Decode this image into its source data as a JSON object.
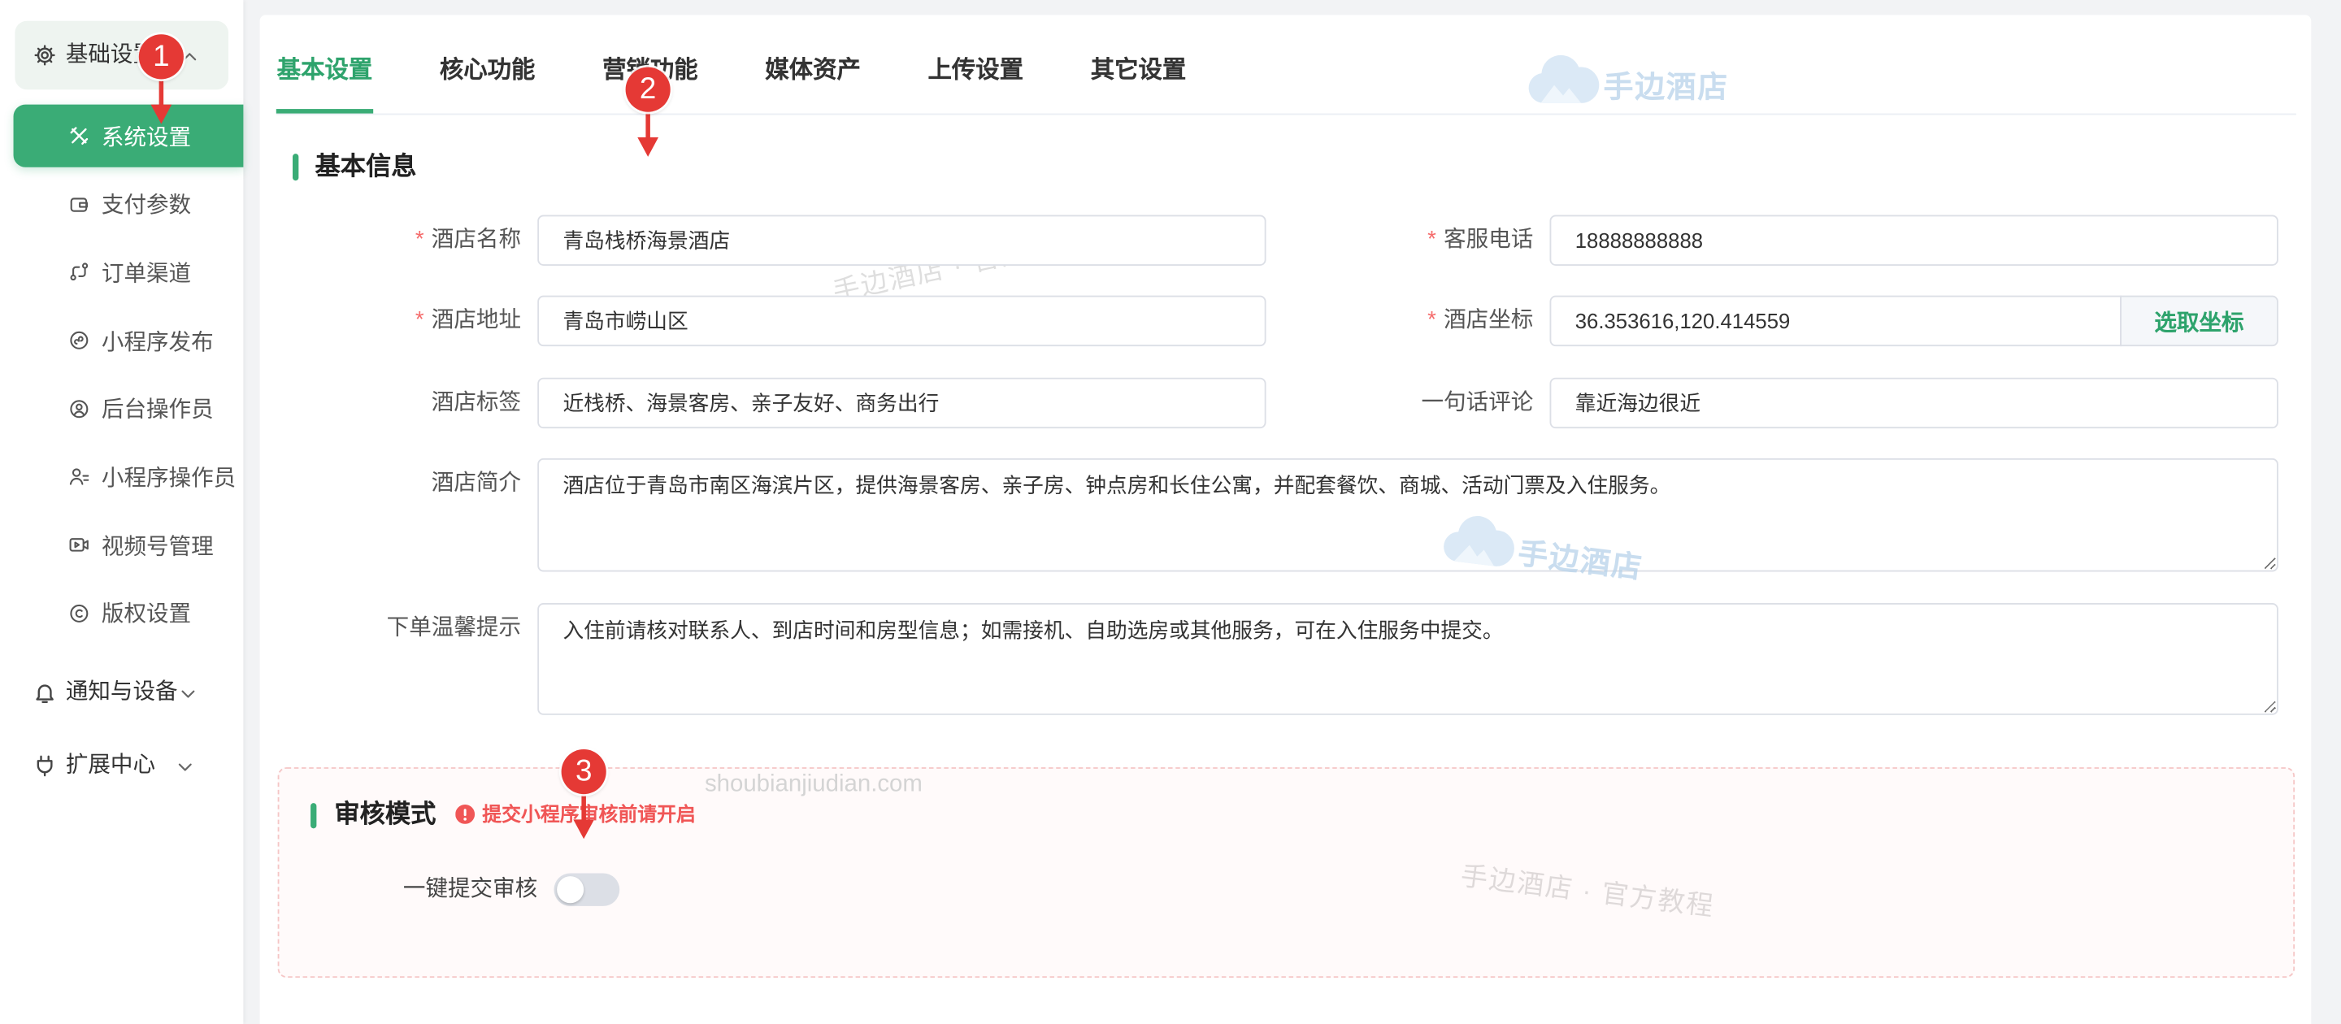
{
  "sidebar": {
    "basic_group": {
      "label": "基础设置",
      "icon": "gear-icon",
      "chevron": "chevron-up-icon"
    },
    "items": [
      {
        "label": "系统设置",
        "icon": "tools-icon",
        "active": true
      },
      {
        "label": "支付参数",
        "icon": "wallet-icon",
        "active": false
      },
      {
        "label": "订单渠道",
        "icon": "route-icon",
        "active": false
      },
      {
        "label": "小程序发布",
        "icon": "mini-program-icon",
        "active": false
      },
      {
        "label": "后台操作员",
        "icon": "user-circle-icon",
        "active": false
      },
      {
        "label": "小程序操作员",
        "icon": "users-icon",
        "active": false
      },
      {
        "label": "视频号管理",
        "icon": "video-icon",
        "active": false
      },
      {
        "label": "版权设置",
        "icon": "copyright-icon",
        "active": false
      }
    ],
    "notify_group": {
      "label": "通知与设备",
      "icon": "bell-icon",
      "chevron": "chevron-down-icon"
    },
    "extend_group": {
      "label": "扩展中心",
      "icon": "plug-icon",
      "chevron": "chevron-down-icon"
    }
  },
  "tabs": [
    {
      "label": "基本设置",
      "active": true
    },
    {
      "label": "核心功能",
      "active": false
    },
    {
      "label": "营销功能",
      "active": false
    },
    {
      "label": "媒体资产",
      "active": false
    },
    {
      "label": "上传设置",
      "active": false
    },
    {
      "label": "其它设置",
      "active": false
    }
  ],
  "basic_info": {
    "title": "基本信息",
    "required_mark": "*",
    "hotel_name": {
      "label": "酒店名称",
      "required": true,
      "value": "青岛栈桥海景酒店"
    },
    "service_phone": {
      "label": "客服电话",
      "required": true,
      "value": "18888888888"
    },
    "hotel_address": {
      "label": "酒店地址",
      "required": true,
      "value": "青岛市崂山区"
    },
    "hotel_coordinates": {
      "label": "酒店坐标",
      "required": true,
      "value": "36.353616,120.414559",
      "button": "选取坐标"
    },
    "hotel_tags": {
      "label": "酒店标签",
      "required": false,
      "value": "近栈桥、海景客房、亲子友好、商务出行"
    },
    "one_line_review": {
      "label": "一句话评论",
      "required": false,
      "value": "靠近海边很近"
    },
    "hotel_intro": {
      "label": "酒店简介",
      "value": "酒店位于青岛市南区海滨片区，提供海景客房、亲子房、钟点房和长住公寓，并配套餐饮、商城、活动门票及入住服务。"
    },
    "order_tips": {
      "label": "下单温馨提示",
      "value": "入住前请核对联系人、到店时间和房型信息；如需接机、自助选房或其他服务，可在入住服务中提交。"
    }
  },
  "audit": {
    "title": "审核模式",
    "warning_icon": "warning-icon",
    "warning": "提交小程序审核前请开启",
    "toggle_label": "一键提交审核",
    "toggle_on": false
  },
  "watermarks": {
    "logo_text": "手边酒店",
    "tutorial_text": "手边酒店 · 官方教程",
    "domain": "shoubianjiudian.com"
  },
  "annotations": [
    {
      "number": "1"
    },
    {
      "number": "2"
    },
    {
      "number": "3"
    }
  ],
  "colors": {
    "primary": "#3aac76",
    "primary_text": "#2ea36c",
    "danger": "#f56c6c",
    "annotation": "#e53935"
  }
}
